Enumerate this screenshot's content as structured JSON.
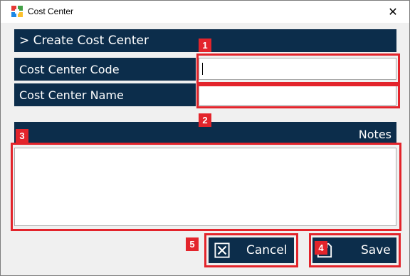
{
  "window": {
    "title": "Cost Center",
    "close_glyph": "✕",
    "icon": "app-grid-icon"
  },
  "form": {
    "header": "> Create Cost Center",
    "code_label": "Cost Center Code",
    "code_value": "",
    "name_label": "Cost Center Name",
    "name_value": "",
    "notes_label": "Notes",
    "notes_value": ""
  },
  "buttons": {
    "cancel": "Cancel",
    "save": "Save"
  },
  "annotations": {
    "b1": "1",
    "b2": "2",
    "b3": "3",
    "b4": "4",
    "b5": "5"
  },
  "colors": {
    "panel": "#0c2d4b",
    "highlight": "#e3242b",
    "background": "#f0f0f0"
  }
}
